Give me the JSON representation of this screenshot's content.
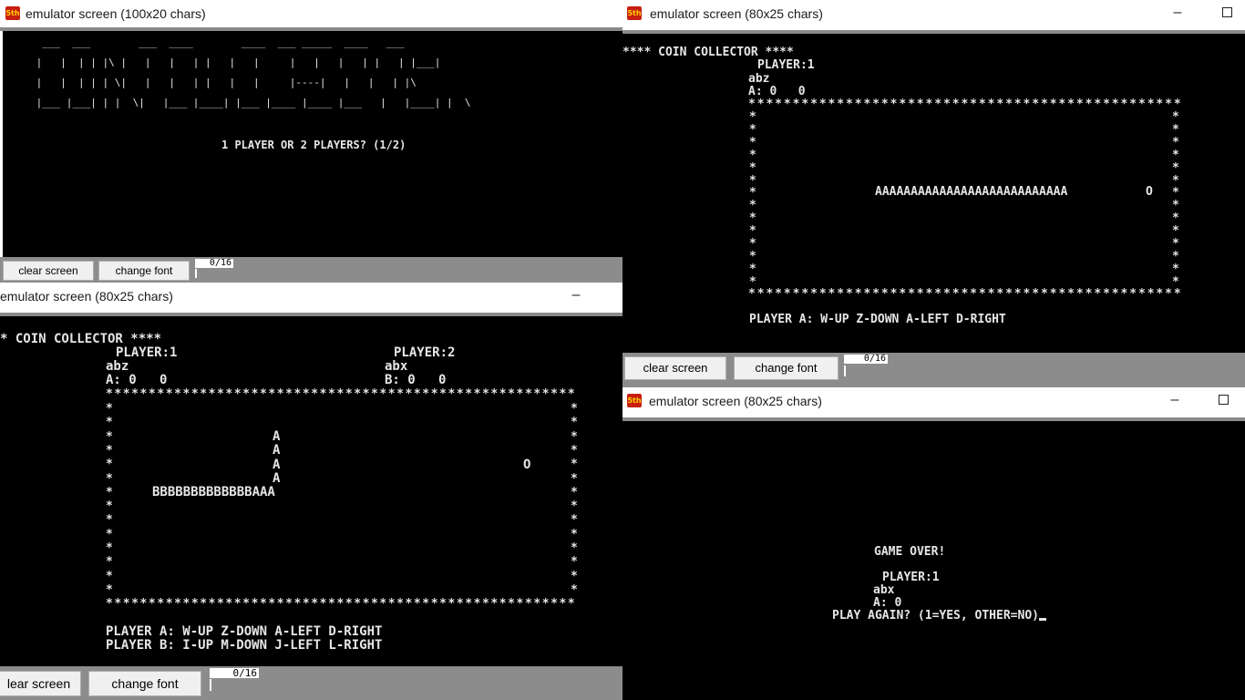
{
  "app_icon_text": "5th",
  "windows": {
    "menu": {
      "title": "emulator screen (100x20 chars)",
      "banner_lines": [
        "  ___  ___        ___  ____        ____  ___ _____  ____   ___",
        " |   |  | | |\\ |   |   |   | |   |   |     |   |   |   | |   | |___|",
        " |   |  | | | \\|   |   |   | |   |   |     |----|   |   |   | |\\",
        " |___ |___| | |  \\|   |___ |____| |___ |____ |____ |___   |   |____| |  \\"
      ],
      "prompt": "1 PLAYER OR 2 PLAYERS? (1/2)",
      "clear_label": "clear screen",
      "font_label": "change font",
      "counter": "0/16"
    },
    "one_player": {
      "title": "emulator screen (80x25 chars)",
      "heading": "**** COIN COLLECTOR ****",
      "player_label": "PLAYER:1",
      "player_name": "abz",
      "score_line": "A: 0   0",
      "border_top": "*************************************************",
      "row_left": "*",
      "row_right": "*",
      "snake_row": "AAAAAAAAAAAAAAAAAAAAAAAAAAA",
      "coin": "O",
      "controls": "PLAYER A: W-UP Z-DOWN A-LEFT D-RIGHT",
      "clear_label": "clear screen",
      "font_label": "change font",
      "counter": "0/16"
    },
    "two_player": {
      "title": "emulator screen (80x25 chars)",
      "heading": "* COIN COLLECTOR ****",
      "p1_label": "PLAYER:1",
      "p1_name": "abz",
      "p1_score": "A: 0   0",
      "p2_label": "PLAYER:2",
      "p2_name": "abx",
      "p2_score": "B: 0   0",
      "border_top": "*******************************************************",
      "snake_a": "A",
      "snake_b_row": "BBBBBBBBBBBBBAAA",
      "coin": "O",
      "controls_a": "PLAYER A: W-UP Z-DOWN A-LEFT D-RIGHT",
      "controls_b": "PLAYER B: I-UP M-DOWN J-LEFT L-RIGHT",
      "clear_label": "lear screen",
      "font_label": "change font",
      "counter": "0/16"
    },
    "game_over": {
      "title": "emulator screen (80x25 chars)",
      "heading": "GAME OVER!",
      "player_label": "PLAYER:1",
      "player_name": "abx",
      "score_line": "A: 0",
      "prompt": "PLAY AGAIN? (1=YES, OTHER=NO)"
    }
  }
}
